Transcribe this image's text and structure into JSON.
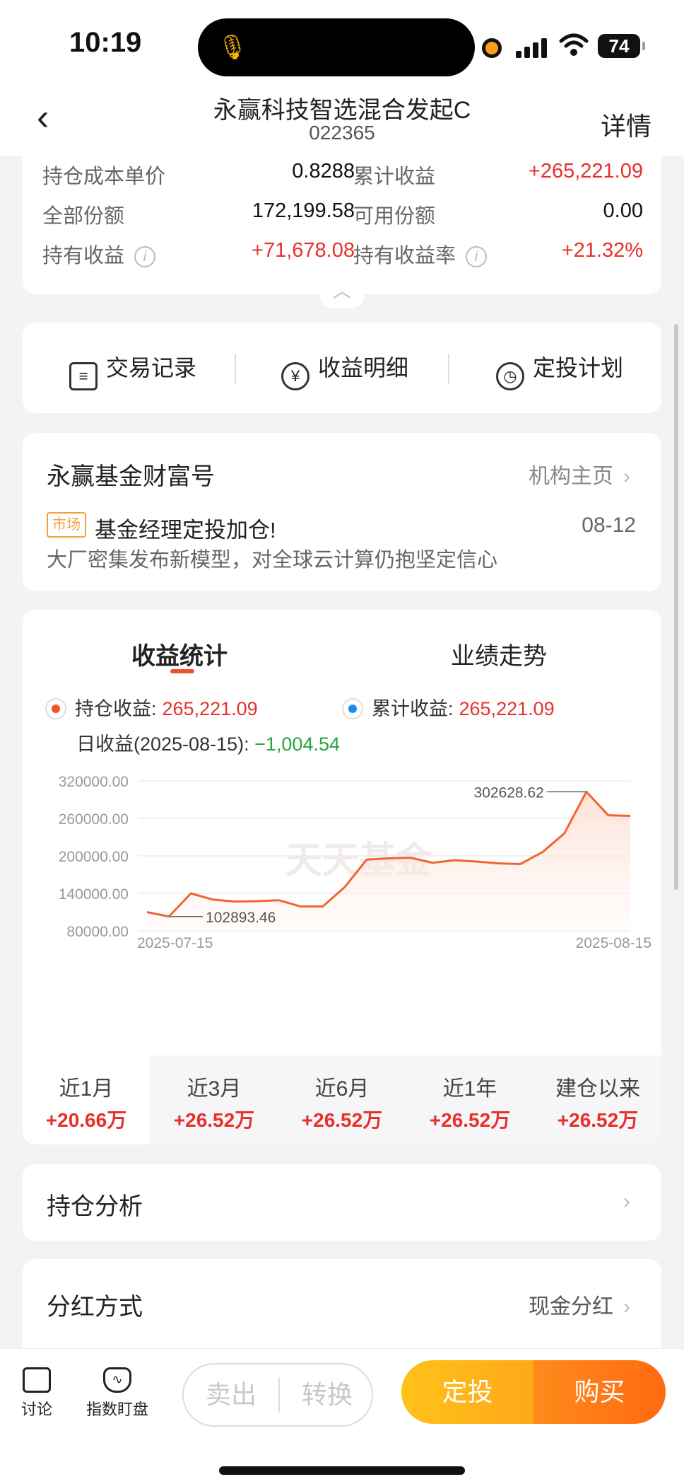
{
  "status_bar": {
    "time": "10:19",
    "battery": "74"
  },
  "nav": {
    "title": "永赢科技智选混合发起C",
    "code": "022365",
    "detail": "详情"
  },
  "holding": {
    "cost_price_label": "持仓成本单价",
    "cost_price": "0.8288",
    "cum_income_label": "累计收益",
    "cum_income": "+265,221.09",
    "total_shares_label": "全部份额",
    "total_shares": "172,199.58",
    "avail_shares_label": "可用份额",
    "avail_shares": "0.00",
    "hold_income_label": "持有收益",
    "hold_income": "+71,678.08",
    "hold_rate_label": "持有收益率",
    "hold_rate": "+21.32%"
  },
  "actions": [
    {
      "label": "交易记录",
      "icon": "receipt-icon"
    },
    {
      "label": "收益明细",
      "icon": "yen-circle-icon"
    },
    {
      "label": "定投计划",
      "icon": "timer-icon"
    }
  ],
  "wealth": {
    "title": "永赢基金财富号",
    "link": "机构主页",
    "tag": "市场",
    "headline": "基金经理定投加仓!",
    "date": "08-12",
    "subtitle": "大厂密集发布新模型，对全球云计算仍抱坚定信心"
  },
  "stats": {
    "tab_income": "收益统计",
    "tab_trend": "业绩走势",
    "legend_hold_label": "持仓收益:",
    "legend_hold_value": "265,221.09",
    "legend_cum_label": "累计收益:",
    "legend_cum_value": "265,221.09",
    "daily_label": "日收益(2025-08-15):",
    "daily_value": "−1,004.54",
    "watermark": "天天基金",
    "colors": {
      "line": "#f0662f",
      "hold_dot": "#f0522a",
      "cum_dot": "#1a8cf0"
    }
  },
  "chart_data": {
    "type": "line",
    "yticks": [
      "320000.00",
      "260000.00",
      "200000.00",
      "140000.00",
      "80000.00"
    ],
    "ylim": [
      80000,
      320000
    ],
    "x_start_label": "2025-07-15",
    "x_end_label": "2025-08-15",
    "series": [
      {
        "values": [
          110000,
          102893.46,
          140000,
          130000,
          127000,
          127500,
          129000,
          119000,
          119000,
          150000,
          194000,
          196000,
          197000,
          189000,
          193000,
          191000,
          188000,
          187000,
          206000,
          236000,
          302628.62,
          265000,
          264000
        ]
      }
    ],
    "annotations": [
      {
        "label": "102893.46",
        "index": 1
      },
      {
        "label": "302628.62",
        "index": 20
      }
    ]
  },
  "periods": [
    {
      "label": "近1月",
      "value": "+20.66万"
    },
    {
      "label": "近3月",
      "value": "+26.52万"
    },
    {
      "label": "近6月",
      "value": "+26.52万"
    },
    {
      "label": "近1年",
      "value": "+26.52万"
    },
    {
      "label": "建仓以来",
      "value": "+26.52万"
    }
  ],
  "analysis": {
    "title": "持仓分析"
  },
  "dividend": {
    "title": "分红方式",
    "value": "现金分红"
  },
  "bottom": {
    "discuss": "讨论",
    "index_watch": "指数盯盘",
    "sell": "卖出",
    "convert": "转换",
    "auto_invest": "定投",
    "buy": "购买"
  }
}
